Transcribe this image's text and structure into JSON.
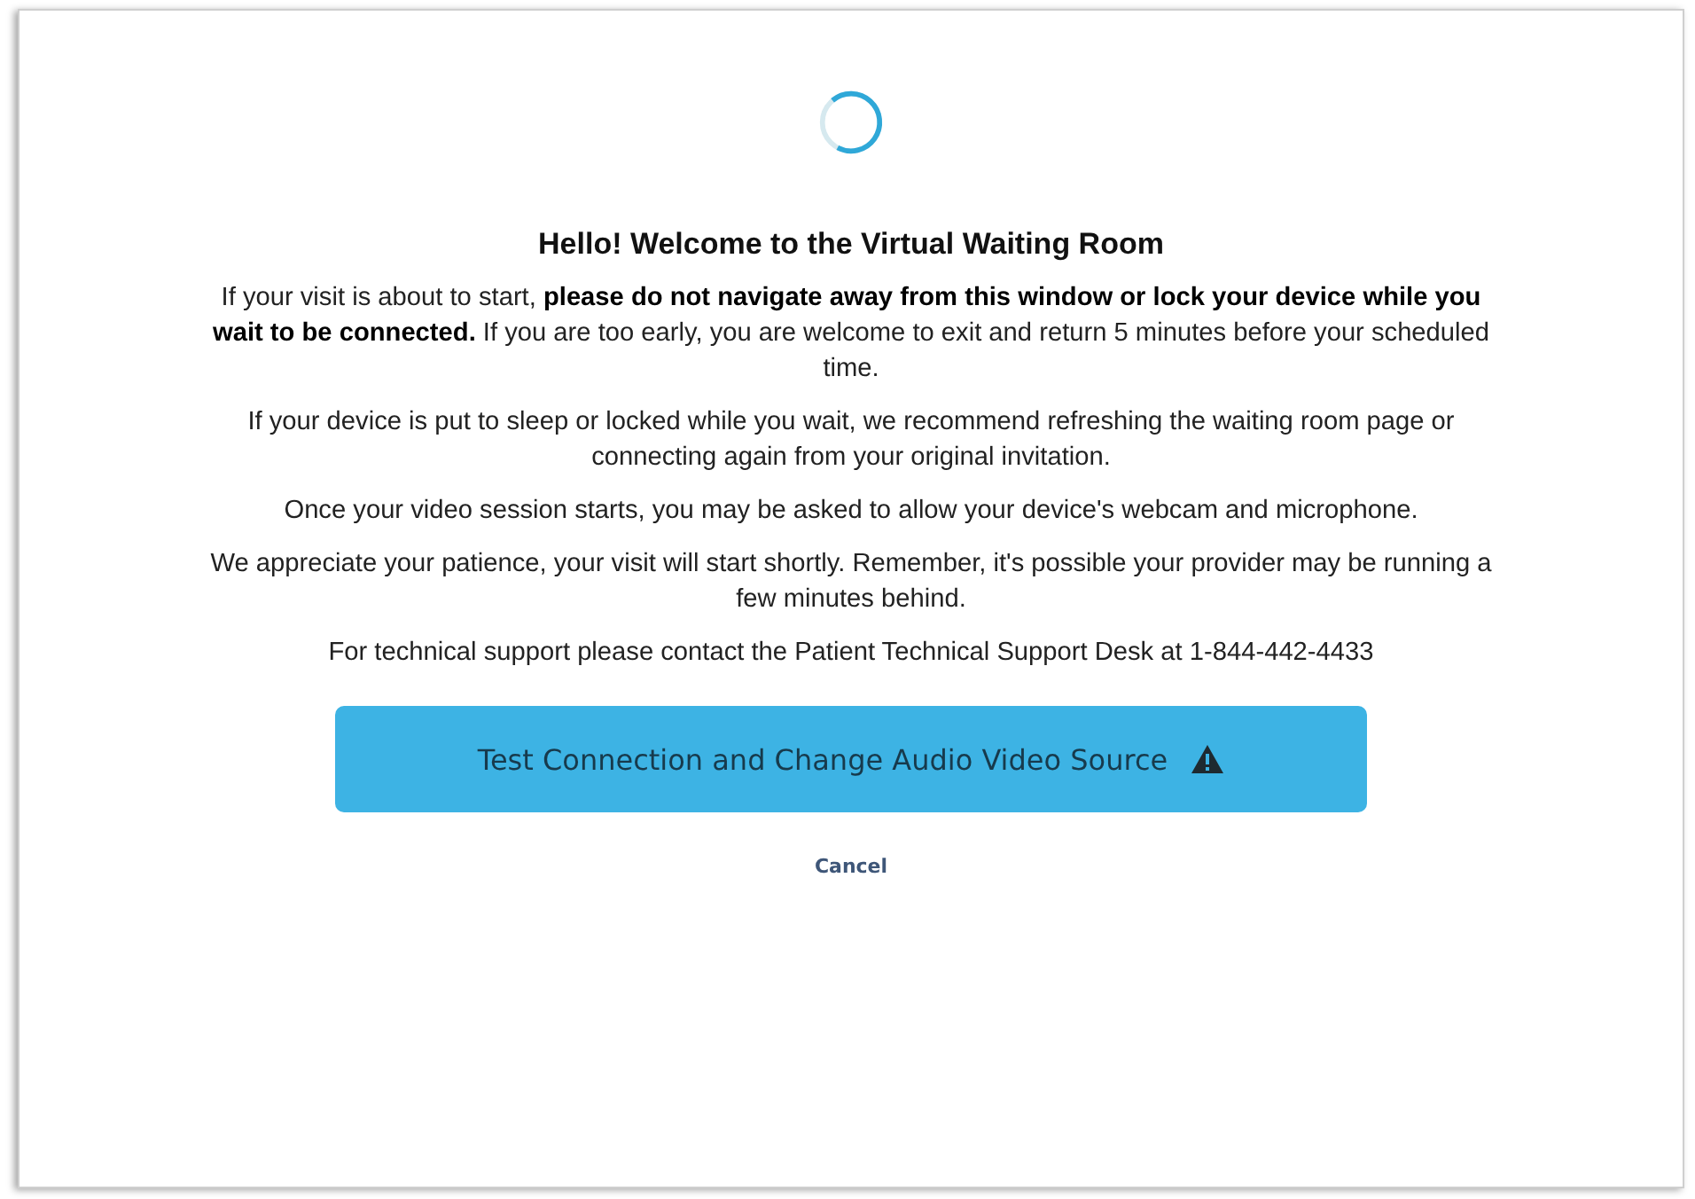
{
  "dialog": {
    "loading": true,
    "title": "Hello! Welcome to the Virtual Waiting Room",
    "paragraphs": [
      "If your visit is about to start, **please do not navigate away from this window or lock your device while you wait to be connected.** If you are too early, you are welcome to exit and return 5 minutes before your scheduled time.",
      "If your device is put to sleep  or locked while you wait, we recommend refreshing the waiting room page or connecting again from your original invitation.",
      "Once your video session starts, you may be asked to allow your device's webcam and microphone.",
      "We appreciate your patience, your visit will start shortly. Remember, it's possible your provider may be running a few minutes behind.",
      "For technical support please contact the Patient Technical Support Desk at 1-844-442-4433"
    ],
    "primary_button": {
      "label": "Test Connection and Change Audio Video Source",
      "warning": true
    },
    "cancel_link": "Cancel"
  }
}
